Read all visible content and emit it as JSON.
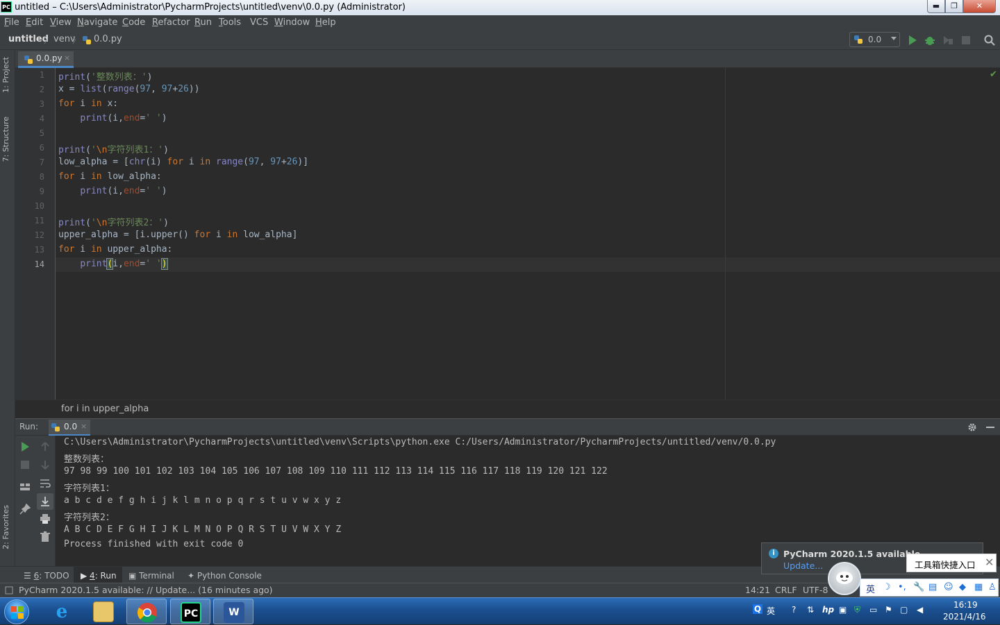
{
  "window": {
    "title": "untitled – C:\\Users\\Administrator\\PycharmProjects\\untitled\\venv\\0.0.py (Administrator)",
    "app_icon_text": "PC",
    "controls": {
      "minimize": "▬",
      "maximize": "❐",
      "close": "✕"
    }
  },
  "menu": [
    {
      "u": "F",
      "rest": "ile"
    },
    {
      "u": "E",
      "rest": "dit"
    },
    {
      "u": "V",
      "rest": "iew"
    },
    {
      "u": "N",
      "rest": "avigate"
    },
    {
      "u": "C",
      "rest": "ode"
    },
    {
      "u": "R",
      "rest": "efactor"
    },
    {
      "u": "R",
      "rest": "un"
    },
    {
      "u": "T",
      "rest": "ools"
    },
    {
      "u": "",
      "rest": "VCS"
    },
    {
      "u": "W",
      "rest": "indow"
    },
    {
      "u": "H",
      "rest": "elp"
    }
  ],
  "navbar": {
    "project": "untitled",
    "folder": "venv",
    "file": "0.0.py",
    "run_config": "0.0",
    "separator": "〉"
  },
  "left_tabs": {
    "project": "1: Project",
    "structure": "7: Structure",
    "favorites": "2: Favorites"
  },
  "editor": {
    "tab_label": "0.0.py",
    "tab_close": "×",
    "current_line": 14,
    "lines": [
      {
        "n": "1",
        "tokens": [
          [
            "bi",
            "print"
          ],
          [
            "",
            "("
          ],
          [
            "st",
            "'整数列表：'"
          ],
          [
            "",
            ")"
          ]
        ]
      },
      {
        "n": "2",
        "tokens": [
          [
            "",
            "x = "
          ],
          [
            "bi",
            "list"
          ],
          [
            "",
            "("
          ],
          [
            "bi",
            "range"
          ],
          [
            "",
            "("
          ],
          [
            "nm",
            "97"
          ],
          [
            "",
            ", "
          ],
          [
            "nm",
            "97"
          ],
          [
            "",
            "+"
          ],
          [
            "nm",
            "26"
          ],
          [
            "",
            "))"
          ]
        ]
      },
      {
        "n": "3",
        "tokens": [
          [
            "kw",
            "for"
          ],
          [
            "",
            " i "
          ],
          [
            "kw",
            "in"
          ],
          [
            "",
            " x:"
          ]
        ]
      },
      {
        "n": "4",
        "tokens": [
          [
            "",
            "    "
          ],
          [
            "bi",
            "print"
          ],
          [
            "",
            "(i,"
          ],
          [
            "pr",
            "end"
          ],
          [
            "",
            "="
          ],
          [
            "st",
            "' '"
          ],
          [
            "",
            ")"
          ]
        ]
      },
      {
        "n": "5",
        "tokens": []
      },
      {
        "n": "6",
        "tokens": [
          [
            "bi",
            "print"
          ],
          [
            "",
            "("
          ],
          [
            "st",
            "'"
          ],
          [
            "es",
            "\\n"
          ],
          [
            "st",
            "字符列表1：'"
          ],
          [
            "",
            ")"
          ]
        ]
      },
      {
        "n": "7",
        "tokens": [
          [
            "",
            "low_alpha = ["
          ],
          [
            "bi",
            "chr"
          ],
          [
            "",
            "(i) "
          ],
          [
            "kw",
            "for"
          ],
          [
            "",
            " i "
          ],
          [
            "kw",
            "in"
          ],
          [
            "",
            " "
          ],
          [
            "bi",
            "range"
          ],
          [
            "",
            "("
          ],
          [
            "nm",
            "97"
          ],
          [
            "",
            ", "
          ],
          [
            "nm",
            "97"
          ],
          [
            "",
            "+"
          ],
          [
            "nm",
            "26"
          ],
          [
            "",
            ")]"
          ]
        ]
      },
      {
        "n": "8",
        "tokens": [
          [
            "kw",
            "for"
          ],
          [
            "",
            " i "
          ],
          [
            "kw",
            "in"
          ],
          [
            "",
            " low_alpha:"
          ]
        ]
      },
      {
        "n": "9",
        "tokens": [
          [
            "",
            "    "
          ],
          [
            "bi",
            "print"
          ],
          [
            "",
            "(i,"
          ],
          [
            "pr",
            "end"
          ],
          [
            "",
            "="
          ],
          [
            "st",
            "' '"
          ],
          [
            "",
            ")"
          ]
        ]
      },
      {
        "n": "10",
        "tokens": []
      },
      {
        "n": "11",
        "tokens": [
          [
            "bi",
            "print"
          ],
          [
            "",
            "("
          ],
          [
            "st",
            "'"
          ],
          [
            "es",
            "\\n"
          ],
          [
            "st",
            "字符列表2：'"
          ],
          [
            "",
            ")"
          ]
        ]
      },
      {
        "n": "12",
        "tokens": [
          [
            "",
            "upper_alpha = [i.upper() "
          ],
          [
            "kw",
            "for"
          ],
          [
            "",
            " i "
          ],
          [
            "kw",
            "in"
          ],
          [
            "",
            " low_alpha]"
          ]
        ]
      },
      {
        "n": "13",
        "tokens": [
          [
            "kw",
            "for"
          ],
          [
            "",
            " i "
          ],
          [
            "kw",
            "in"
          ],
          [
            "",
            " upper_alpha:"
          ]
        ]
      },
      {
        "n": "14",
        "tokens": [
          [
            "",
            "    "
          ],
          [
            "bi",
            "print"
          ],
          [
            "bm",
            "("
          ],
          [
            "",
            "i,"
          ],
          [
            "pr",
            "end"
          ],
          [
            "",
            "="
          ],
          [
            "st",
            "' '"
          ],
          [
            "bm",
            ")"
          ]
        ]
      }
    ],
    "breadcrumb": "for i in upper_alpha"
  },
  "run_panel": {
    "label": "Run:",
    "tab": "0.0",
    "tab_close": "×",
    "console": [
      "C:\\Users\\Administrator\\PycharmProjects\\untitled\\venv\\Scripts\\python.exe C:/Users/Administrator/PycharmProjects/untitled/venv/0.0.py",
      "整数列表：",
      "97 98 99 100 101 102 103 104 105 106 107 108 109 110 111 112 113 114 115 116 117 118 119 120 121 122 ",
      "字符列表1：",
      "a b c d e f g h i j k l m n o p q r s t u v w x y z ",
      "字符列表2：",
      "A B C D E F G H I J K L M N O P Q R S T U V W X Y Z ",
      "Process finished with exit code 0"
    ]
  },
  "bottom_tabs": {
    "todo_u": "6",
    "todo": ": TODO",
    "run_u": "4",
    "run": ": Run",
    "terminal": "Terminal",
    "python_console": "Python Console"
  },
  "status": {
    "message": "PyCharm 2020.1.5 available: // Update... (16 minutes ago)",
    "position": "14:21",
    "line_sep": "CRLF",
    "encoding": "UTF-8"
  },
  "notification": {
    "title": "PyCharm 2020.1.5 available",
    "link": "Update...",
    "icon": "i"
  },
  "ime": {
    "toolbox": "工具箱快捷入口",
    "lang": "英",
    "close": "✕"
  },
  "taskbar": {
    "tray_lang": "英",
    "time": "16:19",
    "date": "2021/4/16",
    "apps": [
      "ie",
      "explorer",
      "chrome",
      "pycharm",
      "word"
    ]
  },
  "colors": {
    "accent": "#4a88c7",
    "editor_bg": "#2b2b2b",
    "panel_bg": "#3c3f41",
    "keyword": "#cc7832",
    "string": "#6a8759",
    "number": "#6897bb"
  }
}
